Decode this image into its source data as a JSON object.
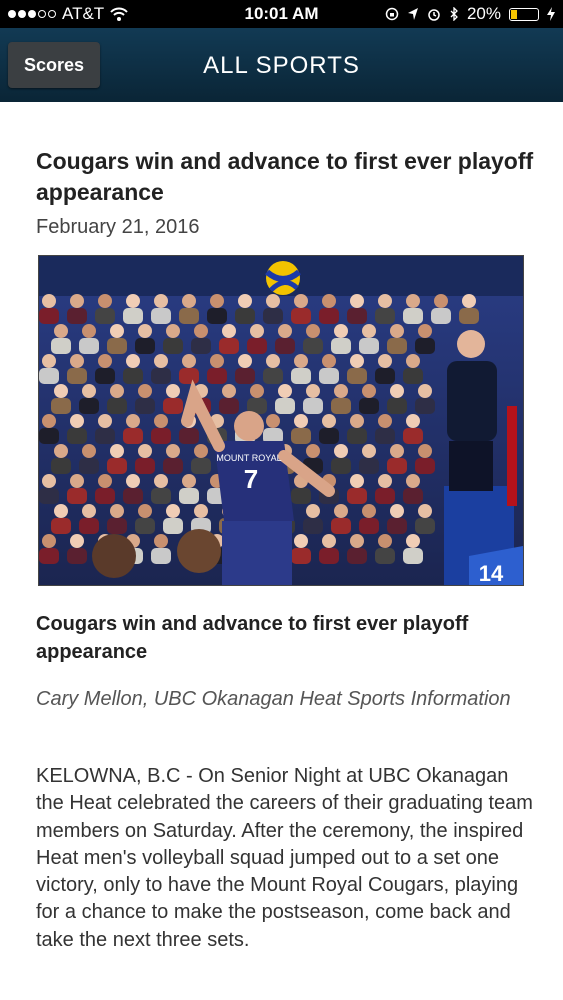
{
  "status_bar": {
    "carrier": "AT&T",
    "time": "10:01 AM",
    "battery": "20%",
    "battery_level": 0.2,
    "signal_bars_filled": 3,
    "signal_bars_total": 5,
    "icons": [
      "wifi-icon",
      "screen-lock-icon",
      "location-icon",
      "alarm-icon",
      "bluetooth-icon",
      "battery-icon",
      "charging-icon"
    ]
  },
  "nav": {
    "back_label": "Scores",
    "title": "ALL SPORTS"
  },
  "article": {
    "headline": "Cougars win and advance to first ever playoff appearance",
    "date": "February 21, 2016",
    "image": {
      "jersey_text": "MOUNT ROYAL",
      "jersey_number": "7",
      "second_jersey_number": "14"
    },
    "subhead": "Cougars win and advance to first ever playoff appearance",
    "byline": "Cary Mellon, UBC Okanagan Heat Sports Information",
    "body": "KELOWNA, B.C - On Senior Night at UBC Okanagan the Heat celebrated the careers of their graduating team members on Saturday. After the ceremony, the inspired Heat men's volleyball squad jumped out to a set one victory, only to have the Mount Royal Cougars, playing for a chance to make the postseason, come back and take the next three sets."
  },
  "colors": {
    "nav_bg": "#0f3249",
    "button_bg": "#3b3f42",
    "jersey": "#26307a",
    "battery_fill": "#f5c400"
  }
}
